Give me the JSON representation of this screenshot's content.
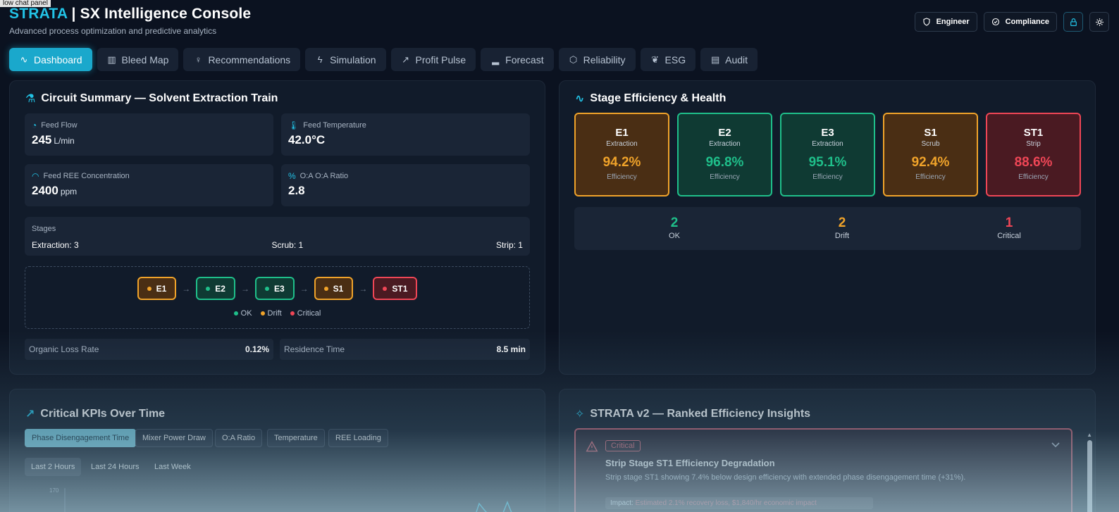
{
  "tooltip": "low chat panel",
  "header": {
    "brand": "STRATA",
    "separator": "|",
    "title": "SX Intelligence Console",
    "subtitle": "Advanced process optimization and predictive analytics"
  },
  "top_actions": {
    "engineer": "Engineer",
    "compliance": "Compliance"
  },
  "tabs": [
    {
      "label": "Dashboard",
      "icon": "activity-icon"
    },
    {
      "label": "Bleed Map",
      "icon": "map-icon"
    },
    {
      "label": "Recommendations",
      "icon": "lightbulb-icon"
    },
    {
      "label": "Simulation",
      "icon": "lightning-icon"
    },
    {
      "label": "Profit Pulse",
      "icon": "trending-up-icon"
    },
    {
      "label": "Forecast",
      "icon": "bar-chart-icon"
    },
    {
      "label": "Reliability",
      "icon": "shield-icon"
    },
    {
      "label": "ESG",
      "icon": "leaf-icon"
    },
    {
      "label": "Audit",
      "icon": "document-icon"
    }
  ],
  "circuit": {
    "title": "Circuit Summary — Solvent Extraction Train",
    "feed_flow": {
      "label": "Feed Flow",
      "value": "245",
      "unit": "L/min"
    },
    "feed_temp": {
      "label": "Feed Temperature",
      "value": "42.0°C"
    },
    "feed_ree": {
      "label": "Feed REE Concentration",
      "value": "2400",
      "unit": "ppm"
    },
    "oa_ratio": {
      "label": "O:A O:A Ratio",
      "value": "2.8"
    },
    "stages": {
      "label": "Stages",
      "extraction": "Extraction: 3",
      "scrub": "Scrub: 1",
      "strip": "Strip: 1"
    },
    "flow_nodes": [
      {
        "name": "E1",
        "status": "drift"
      },
      {
        "name": "E2",
        "status": "ok"
      },
      {
        "name": "E3",
        "status": "ok"
      },
      {
        "name": "S1",
        "status": "drift"
      },
      {
        "name": "ST1",
        "status": "critical"
      }
    ],
    "arrow": "→",
    "legend": {
      "ok": "OK",
      "drift": "Drift",
      "critical": "Critical"
    },
    "organic_loss": {
      "label": "Organic Loss Rate",
      "value": "0.12%"
    },
    "residence": {
      "label": "Residence Time",
      "value": "8.5 min"
    }
  },
  "stage_eff": {
    "title": "Stage Efficiency & Health",
    "eff_label": "Efficiency",
    "cards": [
      {
        "name": "E1",
        "type": "Extraction",
        "value": "94.2%",
        "status": "drift"
      },
      {
        "name": "E2",
        "type": "Extraction",
        "value": "96.8%",
        "status": "ok"
      },
      {
        "name": "E3",
        "type": "Extraction",
        "value": "95.1%",
        "status": "ok"
      },
      {
        "name": "S1",
        "type": "Scrub",
        "value": "92.4%",
        "status": "drift"
      },
      {
        "name": "ST1",
        "type": "Strip",
        "value": "88.6%",
        "status": "critical"
      }
    ],
    "summary": {
      "ok": {
        "count": "2",
        "label": "OK"
      },
      "drift": {
        "count": "2",
        "label": "Drift"
      },
      "critical": {
        "count": "1",
        "label": "Critical"
      }
    }
  },
  "kpis": {
    "title": "Critical KPIs Over Time",
    "tabs": [
      "Phase Disengagement Time",
      "Mixer Power Draw",
      "O:A Ratio",
      "Temperature",
      "REE Loading"
    ],
    "ranges": [
      "Last 2 Hours",
      "Last 24 Hours",
      "Last Week"
    ],
    "y_tick": "170"
  },
  "insights": {
    "title": "STRATA v2 — Ranked Efficiency Insights",
    "badge": "Critical",
    "headline": "Strip Stage ST1 Efficiency Degradation",
    "text": "Strip stage ST1 showing 7.4% below design efficiency with extended phase disengagement time (+31%).",
    "impact_label": "Impact:",
    "impact": "Estimated 2.1% recovery loss, $1,840/hr economic impact"
  },
  "colors": {
    "ok": "#1fbf8a",
    "drift": "#f0a32a",
    "critical": "#ef4656",
    "ok_bg": "#0f3a33",
    "drift_bg": "#4a2e14",
    "critical_bg": "#4a1a22",
    "accent": "#22c3e6"
  }
}
